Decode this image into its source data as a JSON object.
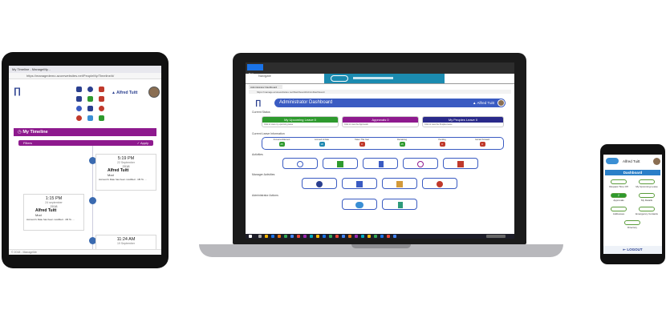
{
  "tablet": {
    "title": "My Timeline - ManageMy...",
    "url": "https://managedemo.azurewebsites.net/PeopleMy/Timeline/#/",
    "user_name": "Alfred Tuitt",
    "timeline_heading": "My Timeline",
    "filters_label": "Filters",
    "apply_label": "Apply",
    "entries": [
      {
        "time": "5:19 PM",
        "date": "22 September",
        "year": "2018",
        "name": "Alfred Tuitt",
        "role": "Mod",
        "message": "Account's Date has been modified - 18/ To ..."
      },
      {
        "time": "1:15 PM",
        "date": "24 september",
        "year": "2018",
        "name": "Alfred Tuitt",
        "role": "Mod",
        "message": "Account's Date has been modified - 18/ To ..."
      },
      {
        "time": "11:24 AM",
        "date": "19 September",
        "year": "2018",
        "name": "",
        "role": "",
        "message": ""
      }
    ],
    "footer": "© 2018 - ManageMe"
  },
  "laptop": {
    "bg_tab": "New",
    "bg_nav": "Navigate",
    "tab_label": "Administrator Dashboard",
    "url": "https://manage.azurewebsites.net/Dashboard/AdminDashboard",
    "dashboard_title": "Administrator Dashboard",
    "user_name": "Alfred Tuitt",
    "sections": {
      "current_status": "Current Status",
      "current_leave": "Current Leave Information",
      "activities": "Activities",
      "manager_activities": "Manager Activities",
      "admin_actions": "Administrator Actions"
    },
    "status_boxes": [
      {
        "title": "My Upcoming Leave",
        "count": "0",
        "body": "Click to view my upcoming leave",
        "color": "#2e9a2e"
      },
      {
        "title": "Approvals",
        "count": "0",
        "body": "Click to view the Approvals",
        "color": "#8e1a8e"
      },
      {
        "title": "My Peoples Leave",
        "count": "0",
        "body": "Click to view the Peoples leave",
        "color": "#2a2a8a"
      }
    ],
    "leave_stats": [
      {
        "label": "Annual entitlement",
        "value": "25",
        "color": "#2e9a2e"
      },
      {
        "label": "Accrued to Date",
        "value": "18",
        "color": "#1d88b0"
      },
      {
        "label": "Taken This Year",
        "value": "0",
        "color": "#c0392b"
      },
      {
        "label": "Remaining",
        "value": "25",
        "color": "#2e9a2e"
      },
      {
        "label": "Pending",
        "value": "0",
        "color": "#c0392b"
      },
      {
        "label": "Carried Forward",
        "value": "0",
        "color": "#c0392b"
      }
    ],
    "activity_icons": [
      "user-icon",
      "briefcase-icon",
      "document-icon",
      "clock-icon",
      "map-icon"
    ],
    "manager_icons": [
      "add-icon",
      "people-icon",
      "thumbs-up-icon",
      "location-icon"
    ],
    "admin_icons": [
      "cloud-icon",
      "report-icon"
    ]
  },
  "phone": {
    "user_name": "Alfred Tuitt",
    "dashboard_label": "Dashboard",
    "tiles": [
      {
        "label": "Request Time Off",
        "badge": ""
      },
      {
        "label": "My Upcoming Leave",
        "badge": ""
      },
      {
        "label": "Approvals",
        "badge": "2"
      },
      {
        "label": "My Details",
        "badge": ""
      },
      {
        "label": "Addresses",
        "badge": ""
      },
      {
        "label": "Emergency Contacts",
        "badge": ""
      },
      {
        "label": "Directory",
        "badge": ""
      }
    ],
    "logout_label": "LOGOUT"
  },
  "colors": {
    "brand_blue": "#3a5bc2",
    "timeline_purple": "#8e1a8e",
    "approve_green": "#2e9a2e"
  }
}
